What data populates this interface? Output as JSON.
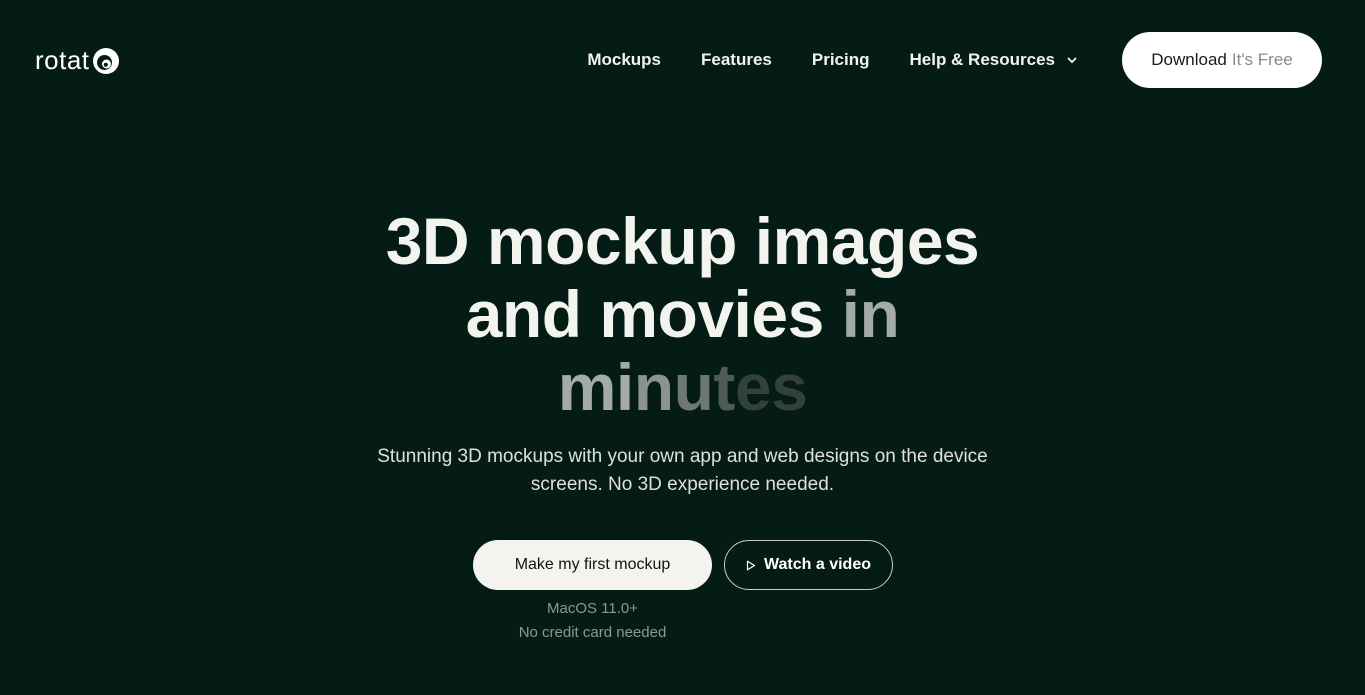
{
  "header": {
    "logo_text": "rotat",
    "logo_mark_icon": "rotato-spiral-icon",
    "nav": {
      "mockups": "Mockups",
      "features": "Features",
      "pricing": "Pricing",
      "help": "Help & Resources"
    },
    "help_chevron_icon": "chevron-down-icon",
    "download": {
      "label": "Download",
      "suffix": "It's Free"
    }
  },
  "hero": {
    "title_line1": "3D mockup images",
    "title_line2_main": "and movies",
    "title_line2_fade": "in",
    "title_line3_fades": [
      "mi",
      "n",
      "u",
      "t",
      "es"
    ],
    "subtitle": "Stunning 3D mockups with your own app and web designs on the device screens. No 3D experience needed.",
    "primary_cta": "Make my first mockup",
    "secondary_cta": "Watch a video",
    "secondary_cta_icon": "play-icon",
    "requirement": "MacOS 11.0+",
    "credit_note": "No credit card needed"
  },
  "colors": {
    "background": "#051b15",
    "text": "#f4f4ef",
    "button_bg": "#ffffff",
    "muted": "#8f9793"
  }
}
